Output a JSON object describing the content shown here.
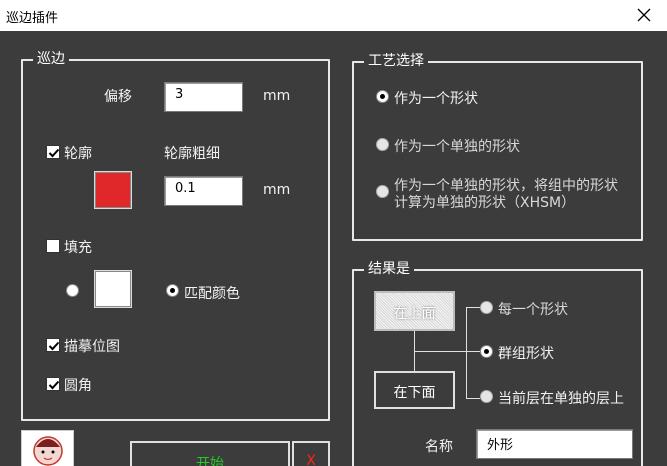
{
  "window": {
    "title": "巡边插件"
  },
  "border_group": {
    "legend": "巡边",
    "offset_label": "偏移",
    "offset_value": "3",
    "offset_unit": "mm",
    "outline_label": "轮廓",
    "outline_checked": true,
    "outline_color": "#e0282b",
    "thickness_label": "轮廓粗细",
    "thickness_value": "0.1",
    "thickness_unit": "mm",
    "fill_label": "填充",
    "fill_checked": false,
    "fill_color": "#ffffff",
    "match_color_label": "匹配颜色",
    "trace_bitmap_label": "描摹位图",
    "trace_bitmap_checked": true,
    "round_corner_label": "圆角",
    "round_corner_checked": true
  },
  "process_group": {
    "legend": "工艺选择",
    "options": [
      "作为一个形状",
      "作为一个单独的形状",
      "作为一个单独的形状，将组中的形状",
      "计算为单独的形状（XHSM）"
    ]
  },
  "result_group": {
    "legend": "结果是",
    "above_button": "在上面",
    "below_button": "在下面",
    "options": [
      "每一个形状",
      "群组形状",
      "当前层在单独的层上"
    ],
    "name_label": "名称",
    "name_value": "外形"
  },
  "actions": {
    "start_label": "开始",
    "close_label": "X"
  },
  "colors": {
    "background": "#3c3c3c",
    "start_text": "#22cc22",
    "close_text": "#ff2020"
  }
}
